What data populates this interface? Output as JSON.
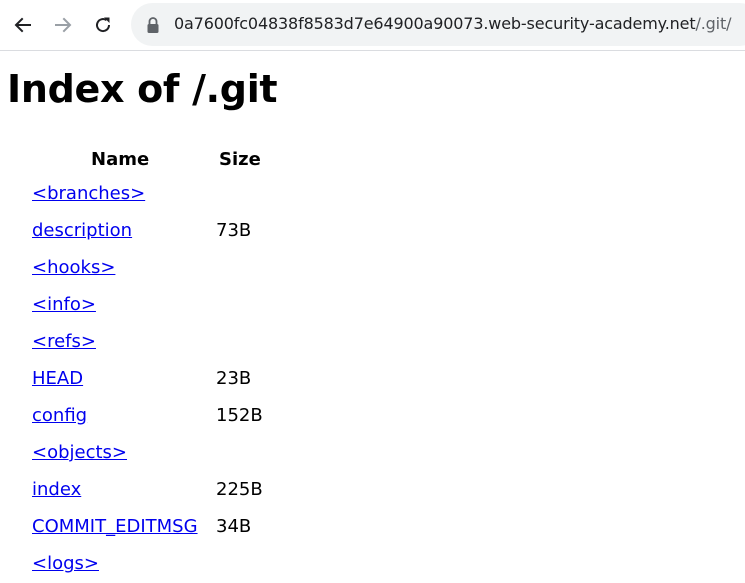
{
  "browser": {
    "url_host": "0a7600fc04838f8583d7e64900a90073.web-security-academy.net",
    "url_path": "/.git/"
  },
  "page": {
    "title": "Index of /.git",
    "columns": {
      "name": "Name",
      "size": "Size"
    },
    "entries": [
      {
        "name": "<branches>",
        "size": ""
      },
      {
        "name": "description",
        "size": "73B"
      },
      {
        "name": "<hooks>",
        "size": ""
      },
      {
        "name": "<info>",
        "size": ""
      },
      {
        "name": "<refs>",
        "size": ""
      },
      {
        "name": "HEAD",
        "size": "23B"
      },
      {
        "name": "config",
        "size": "152B"
      },
      {
        "name": "<objects>",
        "size": ""
      },
      {
        "name": "index",
        "size": "225B"
      },
      {
        "name": "COMMIT_EDITMSG",
        "size": "34B"
      },
      {
        "name": "<logs>",
        "size": ""
      }
    ]
  },
  "icons": {
    "back": "arrow-left-icon",
    "forward": "arrow-right-icon",
    "reload": "reload-icon",
    "secure": "lock-icon"
  },
  "colors": {
    "link": "#0000ee",
    "omnibox": "#f1f3f4"
  }
}
